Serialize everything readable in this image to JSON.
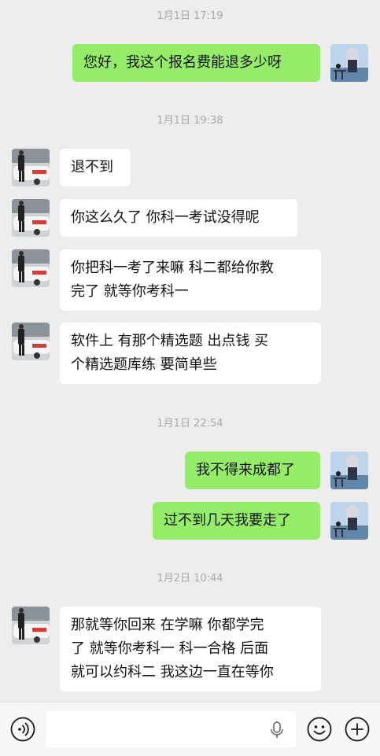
{
  "chat": {
    "timestamps": [
      "1月1日 17:19",
      "1月1日 19:38",
      "1月1日 22:54",
      "1月2日 10:44"
    ],
    "messages": [
      {
        "side": "out",
        "text": "您好，我这个报名费能退多少呀"
      },
      {
        "side": "in",
        "text": "退不到"
      },
      {
        "side": "in",
        "text": "你这么久了 你科一考试没得呢"
      },
      {
        "side": "in",
        "lines": [
          "你把科一考了来嘛  科二都给你教",
          "完了  就等你考科一"
        ]
      },
      {
        "side": "in",
        "lines": [
          "软件上 有那个精选题  出点钱  买",
          "个精选题库练  要简单些"
        ]
      },
      {
        "side": "out",
        "text": "我不得来成都了"
      },
      {
        "side": "out",
        "text": "过不到几天我要走了"
      },
      {
        "side": "in",
        "lines": [
          "那就等你回来 在学嘛  你都学完",
          "了  就等你考科一  科一合格 后面",
          "就可以约科二  我这边一直在等你"
        ]
      }
    ]
  },
  "input_bar": {
    "voice_icon": "voice-icon",
    "mic_icon": "microphone-icon",
    "emoji_icon": "emoji-icon",
    "add_icon": "plus-icon",
    "input_value": ""
  },
  "colors": {
    "background": "#ededed",
    "outgoing_bubble": "#95ec69",
    "incoming_bubble": "#ffffff",
    "timestamp": "#a9a9a9"
  }
}
